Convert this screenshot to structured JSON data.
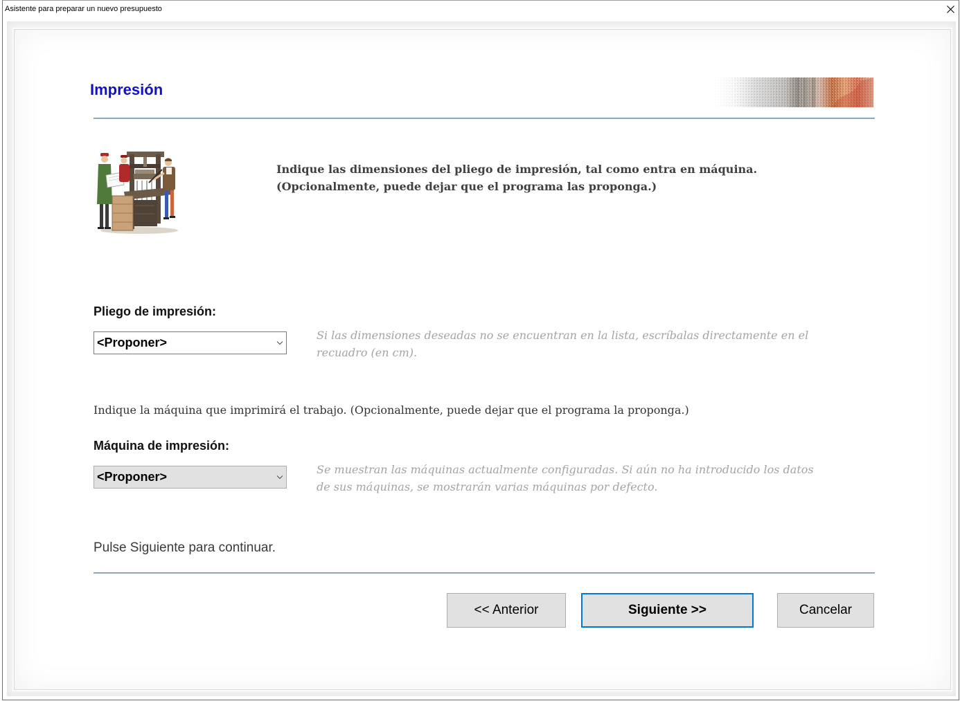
{
  "window": {
    "title": "Asistente para preparar un nuevo presupuesto"
  },
  "header": {
    "title": "Impresión"
  },
  "intro": {
    "lines": [
      "Indique las dimensiones del pliego de impresión, tal como entra en máquina.",
      "(Opcionalmente, puede dejar que el programa las proponga.)"
    ]
  },
  "sheet": {
    "label": "Pliego de impresión:",
    "selected_value": "<Proponer>",
    "hint_lines": [
      "Si las dimensiones deseadas no se encuentran en la lista, escríbalas directamente en el",
      "recuadro (en cm)."
    ]
  },
  "machine": {
    "intro": "Indique la máquina que imprimirá el trabajo. (Opcionalmente, puede dejar que el programa la proponga.)",
    "label": "Máquina de impresión:",
    "selected_value": "<Proponer>",
    "hint_lines": [
      "Se muestran las máquinas actualmente configuradas. Si aún no ha introducido los datos",
      "de sus máquinas, se mostrarán varias máquinas por defecto."
    ]
  },
  "footer": {
    "instruction": "Pulse Siguiente para continuar.",
    "buttons": {
      "back": "<< Anterior",
      "next": "Siguiente >>",
      "cancel": "Cancelar"
    }
  },
  "icons": {
    "close": "close-icon",
    "dropdown": "chevron-down-icon",
    "illustration": "printing-press-illustration"
  },
  "colors": {
    "heading": "#1010c8",
    "focus_border": "#0078d7",
    "hint_text": "#a4a4a4",
    "rule": "#7f9bb8",
    "button_face": "#e1e1e1"
  }
}
